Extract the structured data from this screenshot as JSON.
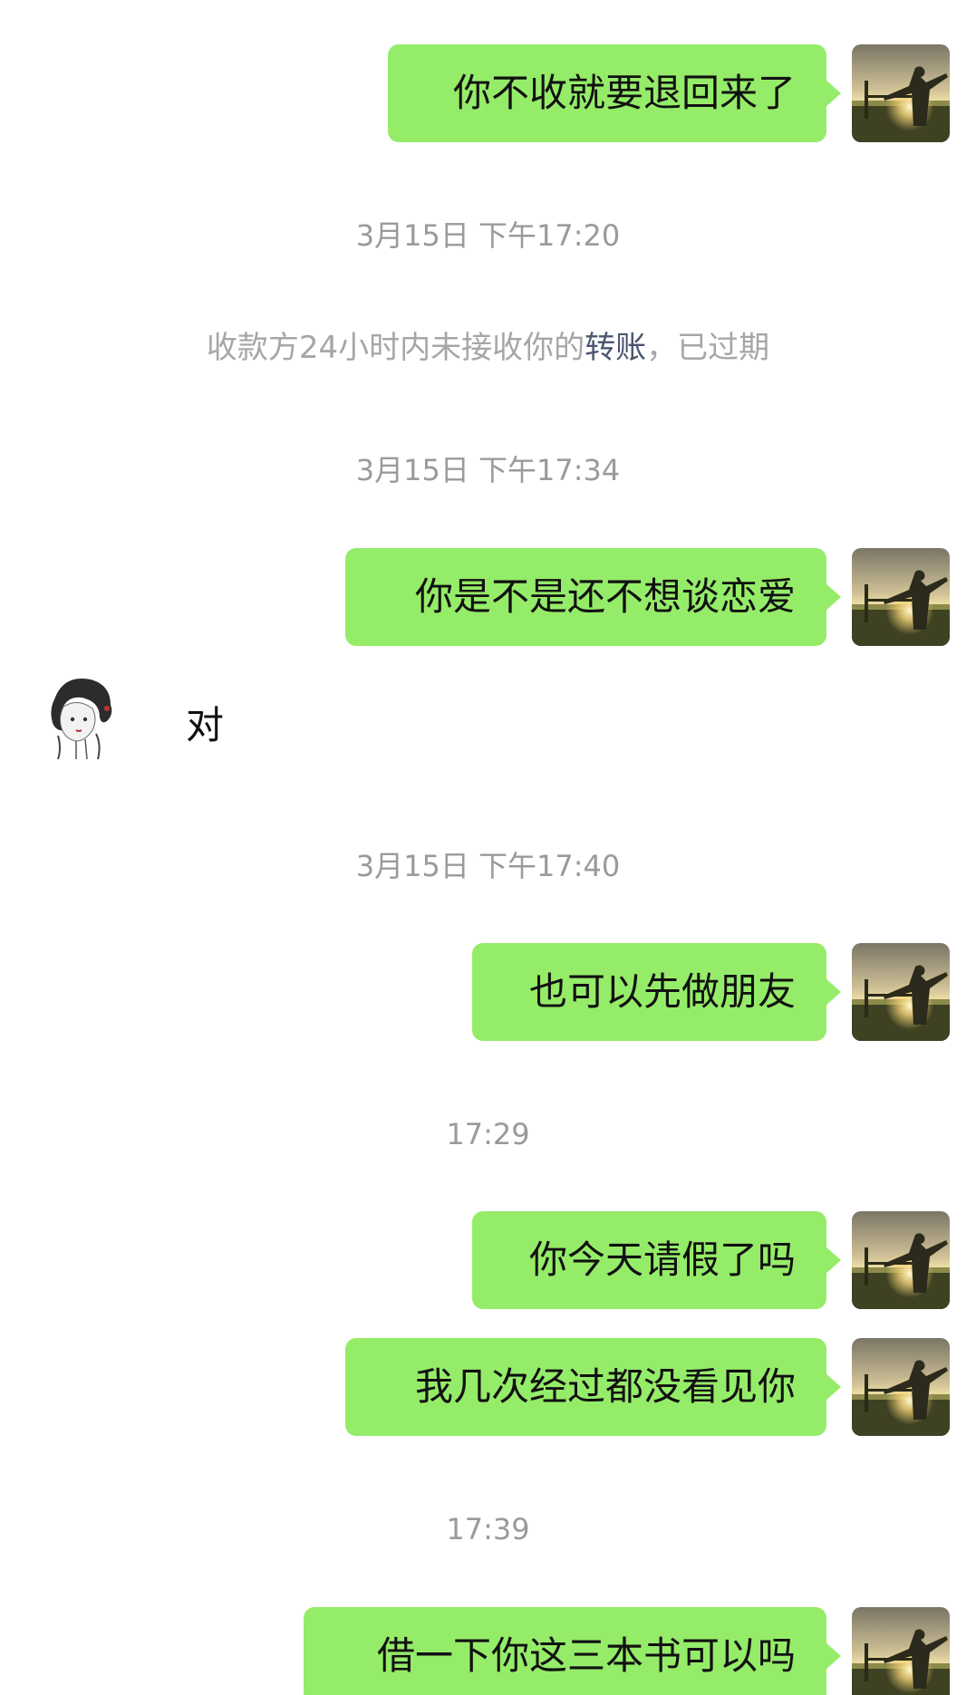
{
  "messages": {
    "m1": "你不收就要退回来了",
    "m2": "你是不是还不想谈恋爱",
    "m3": "对",
    "m4": "也可以先做朋友",
    "m5": "你今天请假了吗",
    "m6": "我几次经过都没看见你",
    "m7": "借一下你这三本书可以吗"
  },
  "timestamps": {
    "t1": "3月15日 下午17:20",
    "t2": "3月15日 下午17:34",
    "t3": "3月15日 下午17:40",
    "t4": "17:29",
    "t5": "17:39"
  },
  "system_notice": {
    "prefix": "收款方24小时内未接收你的",
    "link": "转账",
    "suffix": "，已过期"
  },
  "colors": {
    "bubble_me": "#95ec69",
    "timestamp": "#9a9a9a",
    "system_text": "#a6a6a6",
    "system_link": "#4a5670"
  },
  "icons": {
    "avatar_me": "sunset-silhouette-avatar",
    "avatar_them": "sketch-portrait-avatar"
  }
}
